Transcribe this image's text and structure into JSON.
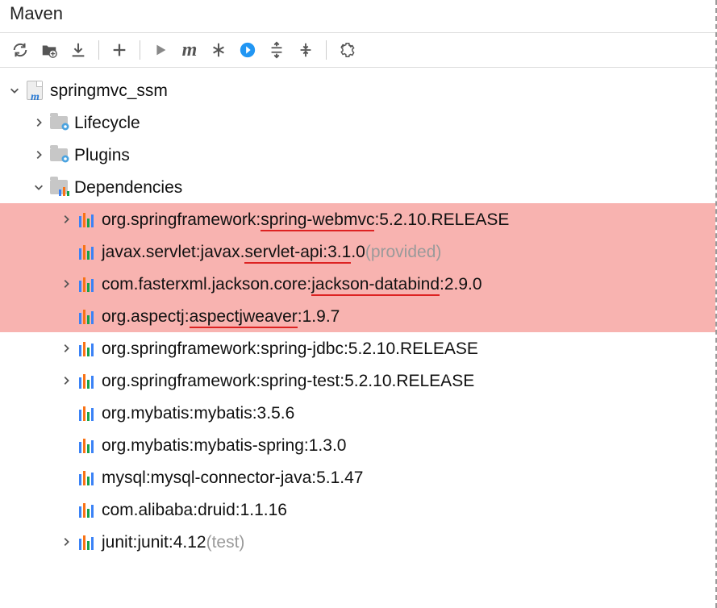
{
  "panel": {
    "title": "Maven"
  },
  "toolbar": {
    "refresh": "Refresh",
    "generate": "Generate",
    "download": "Download",
    "add": "Add",
    "run": "Run",
    "m": "m",
    "skip": "Skip",
    "offline": "Offline",
    "expand": "Expand",
    "collapse": "Collapse",
    "settings": "Settings"
  },
  "tree": {
    "root": "springmvc_ssm",
    "lifecycle": "Lifecycle",
    "plugins": "Plugins",
    "dependencies": "Dependencies",
    "deps": [
      {
        "pre": "org.springframework:",
        "u": "spring-webmvc",
        "post": ":5.2.10.RELEASE",
        "scope": "",
        "expandable": true,
        "hl": true
      },
      {
        "pre": "javax.servlet:javax.",
        "u": "servlet-api:3.1",
        "post": ".0",
        "scope": " (provided)",
        "expandable": false,
        "hl": true
      },
      {
        "pre": "com.fasterxml.jackson.core:",
        "u": "jackson-databind",
        "post": ":2.9.0",
        "scope": "",
        "expandable": true,
        "hl": true
      },
      {
        "pre": "org.aspectj:",
        "u": "aspectjweaver",
        "post": ":1.9.7",
        "scope": "",
        "expandable": false,
        "hl": true
      },
      {
        "pre": "org.springframework:spring-jdbc:5.2.10.RELEASE",
        "u": "",
        "post": "",
        "scope": "",
        "expandable": true,
        "hl": false
      },
      {
        "pre": "org.springframework:spring-test:5.2.10.RELEASE",
        "u": "",
        "post": "",
        "scope": "",
        "expandable": true,
        "hl": false
      },
      {
        "pre": "org.mybatis:mybatis:3.5.6",
        "u": "",
        "post": "",
        "scope": "",
        "expandable": false,
        "hl": false
      },
      {
        "pre": "org.mybatis:mybatis-spring:1.3.0",
        "u": "",
        "post": "",
        "scope": "",
        "expandable": false,
        "hl": false
      },
      {
        "pre": "mysql:mysql-connector-java:5.1.47",
        "u": "",
        "post": "",
        "scope": "",
        "expandable": false,
        "hl": false
      },
      {
        "pre": "com.alibaba:druid:1.1.16",
        "u": "",
        "post": "",
        "scope": "",
        "expandable": false,
        "hl": false
      },
      {
        "pre": "junit:junit:4.12",
        "u": "",
        "post": "",
        "scope": " (test)",
        "expandable": true,
        "hl": false
      }
    ]
  }
}
